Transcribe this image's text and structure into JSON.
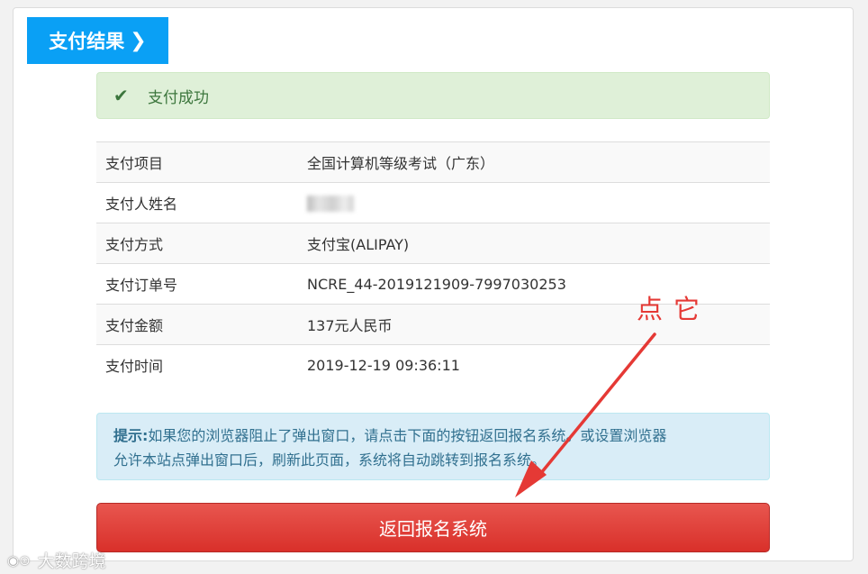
{
  "header": {
    "tab_label": "支付结果",
    "tab_icon": "chevron-right-icon"
  },
  "success_alert": {
    "icon": "check-icon",
    "text": "支付成功"
  },
  "details": [
    {
      "label": "支付项目",
      "value": "全国计算机等级考试（广东）"
    },
    {
      "label": "支付人姓名",
      "value": ""
    },
    {
      "label": "支付方式",
      "value": "支付宝(ALIPAY)"
    },
    {
      "label": "支付订单号",
      "value": "NCRE_44-2019121909-7997030253"
    },
    {
      "label": "支付金额",
      "value": "137元人民币"
    },
    {
      "label": "支付时间",
      "value": "2019-12-19 09:36:11"
    }
  ],
  "info_alert": {
    "title": "提示:",
    "line1": "如果您的浏览器阻止了弹出窗口，请点击下面的按钮返回报名系统。或设置浏览器",
    "line2": "允许本站点弹出窗口后，刷新此页面，系统将自动跳转到报名系统。"
  },
  "return_button": {
    "label": "返回报名系统"
  },
  "annotation": {
    "text": "点它",
    "color": "#e53935"
  },
  "watermark": {
    "text": "大数跨境"
  },
  "colors": {
    "tab_blue": "#0aa0f5",
    "success_bg": "#dff0d8",
    "info_bg": "#d9edf7",
    "button_red": "#d9302a"
  }
}
